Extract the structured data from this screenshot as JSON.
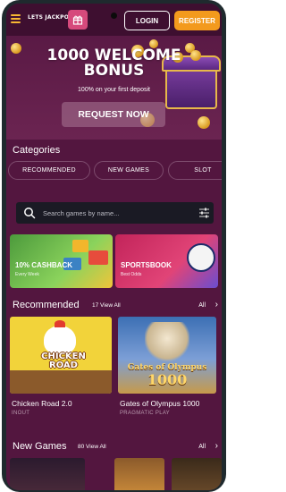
{
  "header": {
    "logo": "LETS JACKPOT",
    "login_label": "LOGIN",
    "register_label": "REGISTER"
  },
  "hero": {
    "title_line1": "1000 WELCOME",
    "title_line2": "BONUS",
    "subtitle": "100% on your first deposit",
    "cta_label": "REQUEST NOW"
  },
  "categories": {
    "title": "Categories",
    "items": [
      "RECOMMENDED",
      "NEW GAMES",
      "SLOT"
    ]
  },
  "search": {
    "placeholder": "Search games by name..."
  },
  "promos": [
    {
      "label": "10% CASHBACK",
      "sub": "Every Week"
    },
    {
      "label": "SPORTSBOOK",
      "sub": "Best Odds"
    }
  ],
  "recommended": {
    "title": "Recommended",
    "count": "17 View All",
    "all_label": "All",
    "arrow": "›",
    "games": [
      {
        "name": "Chicken Road 2.0",
        "provider": "INOUT",
        "art_text": "CHICKEN ROAD"
      },
      {
        "name": "Gates of Olympus 1000",
        "provider": "PRAGMATIC PLAY",
        "art_text": "Gates of Olympus",
        "art_num": "1000"
      }
    ]
  },
  "new_games": {
    "title": "New Games",
    "count": "80 View All",
    "all_label": "All",
    "arrow": "›"
  },
  "colors": {
    "background": "#53163f",
    "header": "#3e0f30",
    "accent": "#f39a1d",
    "gift": "#d64a7c"
  }
}
